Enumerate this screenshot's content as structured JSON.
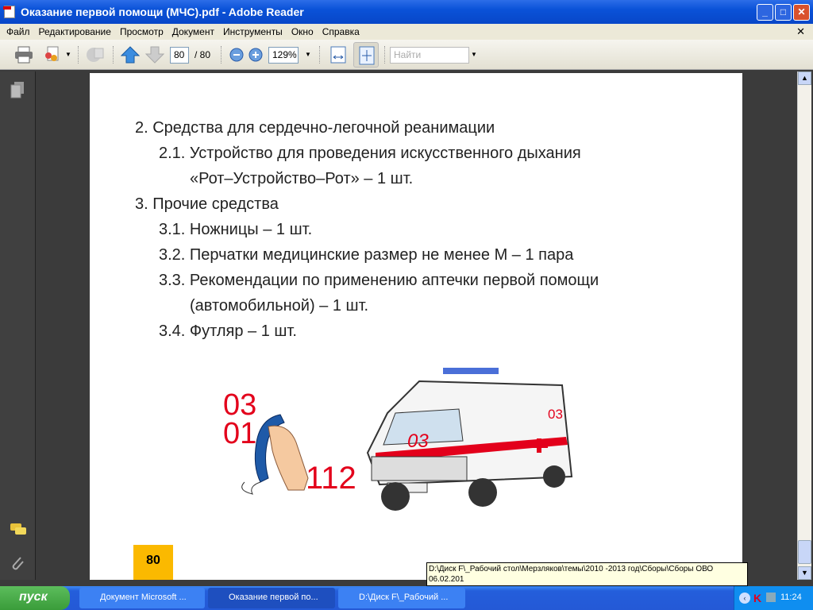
{
  "window": {
    "title": "Оказание первой помощи (МЧС).pdf - Adobe Reader"
  },
  "menu": [
    "Файл",
    "Редактирование",
    "Просмотр",
    "Документ",
    "Инструменты",
    "Окно",
    "Справка"
  ],
  "toolbar": {
    "page_current": "80",
    "page_total": "/ 80",
    "zoom": "129%",
    "find_placeholder": "Найти"
  },
  "document": {
    "lines": [
      "2. Средства для сердечно-легочной реанимации",
      "2.1. Устройство для проведения искусственного дыхания",
      "«Рот–Устройство–Рот» – 1 шт.",
      "3. Прочие средства",
      "3.1. Ножницы – 1 шт.",
      "3.2. Перчатки медицинские размер не менее М – 1 пара",
      "3.3. Рекомендации по применению аптечки первой помощи",
      "(автомобильной) – 1 шт.",
      "3.4. Футляр – 1 шт."
    ],
    "illustration": {
      "phone_numbers": [
        "03",
        "01",
        "112"
      ],
      "ambulance_label": "03"
    },
    "page_number": "80"
  },
  "tooltip": {
    "line1": "D:\\Диск F\\_Рабочий стол\\Мерзляков\\темы\\2010 -2013 год\\Сборы\\Сборы ОВО",
    "line2": "06.02.201"
  },
  "taskbar": {
    "start": "пуск",
    "tasks": [
      "Документ Microsoft ...",
      "Оказание первой по...",
      "D:\\Диск F\\_Рабочий ..."
    ],
    "clock": "11:24"
  },
  "colors": {
    "accent_red": "#e3001b",
    "page_badge": "#fbb900"
  }
}
